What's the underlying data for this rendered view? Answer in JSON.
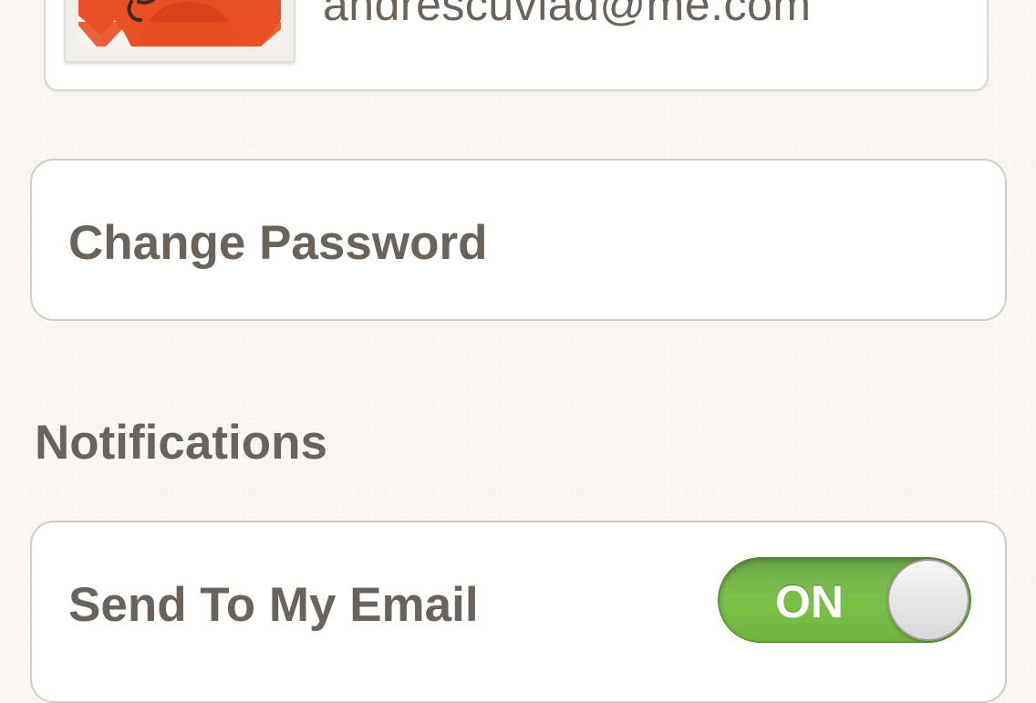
{
  "account": {
    "email": "andrescuvlad@me.com",
    "avatar_icon": "profile-photo"
  },
  "password": {
    "label": "Change Password"
  },
  "notifications": {
    "heading": "Notifications",
    "send_to_email_label": "Send To My Email",
    "toggle": {
      "state_label": "ON",
      "on": true
    }
  },
  "colors": {
    "background": "#f8f7f1",
    "text": "#6b625c",
    "toggle_on": "#6ab23a",
    "avatar_accent": "#e8502a"
  }
}
